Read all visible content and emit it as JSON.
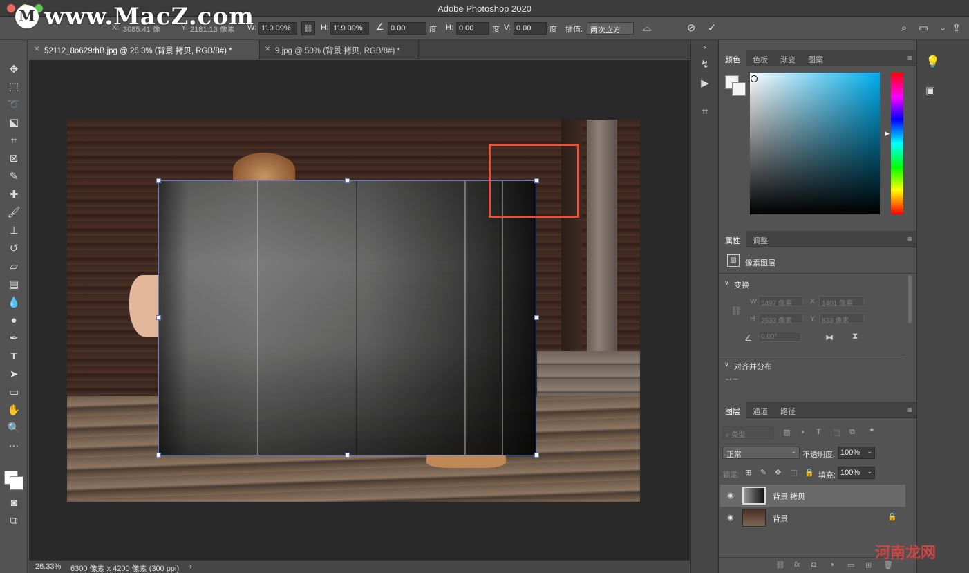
{
  "window": {
    "title": "Adobe Photoshop 2020"
  },
  "watermark": {
    "logo": "M",
    "text": "www.MacZ.com",
    "corner": "河南龙网"
  },
  "options": {
    "x_label": "X:",
    "x_value": "3085.41 像",
    "y_label": "Y:",
    "y_value": "2181.13 像素",
    "w_label": "W:",
    "w_value": "119.09%",
    "h_label": "H:",
    "h_value": "119.09%",
    "angle_value": "0.00",
    "angle_unit": "度",
    "hskew_label": "H:",
    "hskew_value": "0.00",
    "hskew_unit": "度",
    "vskew_label": "V:",
    "vskew_value": "0.00",
    "vskew_unit": "度",
    "interp_label": "插值:",
    "interp_value": "两次立方"
  },
  "tabs": [
    {
      "label": "52112_8o629rhB.jpg @ 26.3% (背景 拷贝, RGB/8#) *"
    },
    {
      "label": "9.jpg @ 50% (背景 拷贝, RGB/8#) *"
    }
  ],
  "status": {
    "zoom": "26.33%",
    "doc_info": "6300 像素 x 4200 像素 (300 ppi)"
  },
  "color_panel": {
    "tabs": [
      "颜色",
      "色板",
      "渐变",
      "图案"
    ]
  },
  "properties_panel": {
    "tabs": [
      "属性",
      "调整"
    ],
    "layer_type": "像素图层",
    "transform_title": "变换",
    "w_label": "W",
    "w_value": "3497 像素",
    "x_label": "X",
    "x_value": "1401 像素",
    "h_label": "H",
    "h_value": "2533 像素",
    "y_label": "Y",
    "y_value": "833 像素",
    "angle_value": "0.00°",
    "align_title": "对齐并分布",
    "align_sub": "对齐:"
  },
  "layers_panel": {
    "tabs": [
      "图层",
      "通道",
      "路径"
    ],
    "filter_label": "类型",
    "blend_mode": "正常",
    "opacity_label": "不透明度:",
    "opacity_value": "100%",
    "lock_label": "锁定:",
    "fill_label": "填充:",
    "fill_value": "100%",
    "layers": [
      {
        "name": "背景 拷贝"
      },
      {
        "name": "背景"
      }
    ]
  }
}
